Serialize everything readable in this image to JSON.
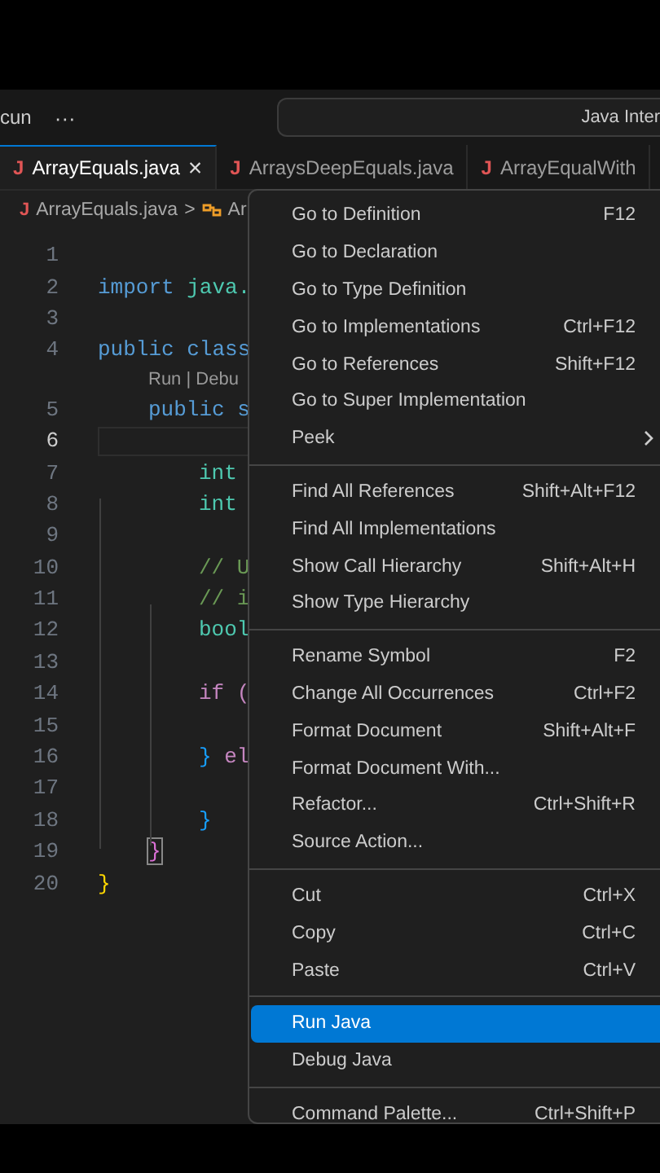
{
  "title_bar": {
    "menu_text": "cun",
    "more": "···",
    "search_text": "Java Inter"
  },
  "tabs": [
    {
      "icon": "J",
      "label": "ArrayEquals.java",
      "selected": true,
      "close": "×"
    },
    {
      "icon": "J",
      "label": "ArraysDeepEquals.java",
      "selected": false
    },
    {
      "icon": "J",
      "label": "ArrayEqualWith",
      "selected": false
    }
  ],
  "breadcrumb": {
    "icon": "J",
    "file": "ArrayEquals.java",
    "separator": ">",
    "symbol": "Ar"
  },
  "code": {
    "lines": [
      {
        "number": "1",
        "current": false
      },
      {
        "number": "2",
        "current": false,
        "kind": "top",
        "tokens": [
          {
            "kind": "keyword",
            "text": "import"
          },
          {
            "kind": "type",
            "text": " java."
          }
        ]
      },
      {
        "number": "3",
        "current": false
      },
      {
        "number": "4",
        "current": false,
        "kind": "top",
        "tokens": [
          {
            "kind": "keyword",
            "text": "public class"
          }
        ]
      },
      {
        "number": "5",
        "current": false,
        "codelens": "Run | Debu",
        "kind": "class",
        "tokens": [
          {
            "kind": "keyword",
            "text": "public s"
          }
        ]
      },
      {
        "number": "6",
        "current": true
      },
      {
        "number": "7",
        "current": false,
        "kind": "method",
        "tokens": [
          {
            "kind": "type",
            "text": "int"
          }
        ]
      },
      {
        "number": "8",
        "current": false,
        "kind": "method",
        "tokens": [
          {
            "kind": "type",
            "text": "int"
          }
        ]
      },
      {
        "number": "9",
        "current": false
      },
      {
        "number": "10",
        "current": false,
        "kind": "method",
        "tokens": [
          {
            "kind": "comment",
            "text": "// U"
          }
        ]
      },
      {
        "number": "11",
        "current": false,
        "kind": "method",
        "tokens": [
          {
            "kind": "comment",
            "text": "// i"
          }
        ]
      },
      {
        "number": "12",
        "current": false,
        "kind": "method",
        "tokens": [
          {
            "kind": "type",
            "text": "bool"
          }
        ]
      },
      {
        "number": "13",
        "current": false
      },
      {
        "number": "14",
        "current": false,
        "kind": "method",
        "tokens": [
          {
            "kind": "control",
            "text": "if ("
          }
        ]
      },
      {
        "number": "15",
        "current": false
      },
      {
        "number": "16",
        "current": false,
        "kind": "method",
        "tokens": [
          {
            "kind": "brace-blue",
            "text": "}"
          },
          {
            "kind": "control",
            "text": " el"
          }
        ]
      },
      {
        "number": "17",
        "current": false
      },
      {
        "number": "18",
        "current": false,
        "kind": "method",
        "tokens": [
          {
            "kind": "brace-blue",
            "text": "}"
          }
        ]
      },
      {
        "number": "19",
        "current": false,
        "kind": "class",
        "tokens": [
          {
            "kind": "brace-match",
            "text": "}"
          }
        ]
      },
      {
        "number": "20",
        "current": false,
        "kind": "top",
        "tokens": [
          {
            "kind": "brace-yellow",
            "text": "}"
          }
        ]
      }
    ]
  },
  "context_menu": {
    "groups": [
      [
        {
          "label": "Go to Definition",
          "shortcut": "F12",
          "selected": false
        },
        {
          "label": "Go to Declaration",
          "selected": false
        },
        {
          "label": "Go to Type Definition",
          "selected": false
        },
        {
          "label": "Go to Implementations",
          "shortcut": "Ctrl+F12",
          "selected": false
        },
        {
          "label": "Go to References",
          "shortcut": "Shift+F12",
          "selected": false
        },
        {
          "label": "Go to Super Implementation",
          "selected": false
        },
        {
          "label": "Peek",
          "submenu": true,
          "selected": false
        }
      ],
      [
        {
          "label": "Find All References",
          "shortcut": "Shift+Alt+F12",
          "selected": false
        },
        {
          "label": "Find All Implementations",
          "selected": false
        },
        {
          "label": "Show Call Hierarchy",
          "shortcut": "Shift+Alt+H",
          "selected": false
        },
        {
          "label": "Show Type Hierarchy",
          "selected": false
        }
      ],
      [
        {
          "label": "Rename Symbol",
          "shortcut": "F2",
          "selected": false
        },
        {
          "label": "Change All Occurrences",
          "shortcut": "Ctrl+F2",
          "selected": false
        },
        {
          "label": "Format Document",
          "shortcut": "Shift+Alt+F",
          "selected": false
        },
        {
          "label": "Format Document With...",
          "selected": false
        },
        {
          "label": "Refactor...",
          "shortcut": "Ctrl+Shift+R",
          "selected": false
        },
        {
          "label": "Source Action...",
          "selected": false
        }
      ],
      [
        {
          "label": "Cut",
          "shortcut": "Ctrl+X",
          "selected": false
        },
        {
          "label": "Copy",
          "shortcut": "Ctrl+C",
          "selected": false
        },
        {
          "label": "Paste",
          "shortcut": "Ctrl+V",
          "selected": false
        }
      ],
      [
        {
          "label": "Run Java",
          "selected": true
        },
        {
          "label": "Debug Java",
          "selected": false
        }
      ],
      [
        {
          "label": "Command Palette...",
          "shortcut": "Ctrl+Shift+P",
          "selected": false
        }
      ]
    ]
  }
}
